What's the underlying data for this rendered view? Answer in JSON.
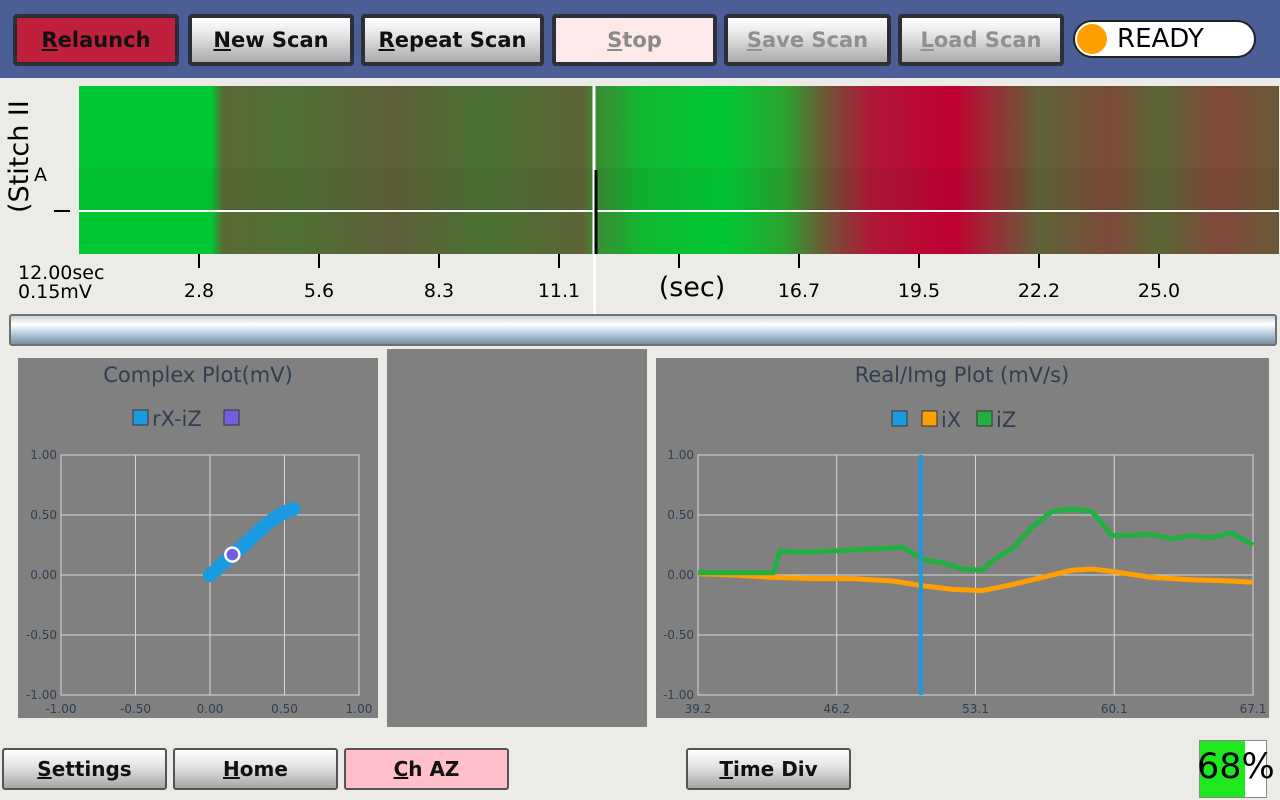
{
  "toolbar": {
    "relaunch": "Relaunch",
    "new_scan": "New Scan",
    "repeat_scan": "Repeat Scan",
    "stop": "Stop",
    "save_scan": "Save Scan",
    "load_scan": "Load Scan",
    "status": "READY",
    "status_color": "#ff9f00"
  },
  "strip": {
    "side_label": "(Stitch II",
    "channel_label": "A",
    "time_div": "12.00sec",
    "volt_div": "0.15mV",
    "axis_unit": "(sec)",
    "ticks": [
      "2.8",
      "5.6",
      "8.3",
      "11.1",
      "16.7",
      "19.5",
      "22.2",
      "25.0"
    ]
  },
  "complex_plot": {
    "title": "Complex Plot(mV)",
    "legend": [
      {
        "label": "rX-iZ",
        "color": "#1a9ae0"
      },
      {
        "label": "",
        "color": "#7060e0"
      }
    ]
  },
  "realimg_plot": {
    "title": "Real/Img Plot (mV/s)",
    "legend": [
      {
        "label": "",
        "color": "#1a9ae0"
      },
      {
        "label": "iX",
        "color": "#ffa000"
      },
      {
        "label": "iZ",
        "color": "#20b040"
      }
    ]
  },
  "chart_data": [
    {
      "type": "scatter",
      "title": "Complex Plot(mV)",
      "xlim": [
        -1.0,
        1.0
      ],
      "ylim": [
        -1.0,
        1.0
      ],
      "xticks": [
        "-1.00",
        "-0.50",
        "0.00",
        "0.50",
        "1.00"
      ],
      "yticks": [
        "1.00",
        "0.50",
        "0.00",
        "-0.50",
        "-1.00"
      ],
      "grid": true,
      "series": [
        {
          "name": "rX-iZ",
          "color": "#1a9ae0",
          "points": [
            [
              0.0,
              0.0
            ],
            [
              0.02,
              0.02
            ],
            [
              0.04,
              0.04
            ],
            [
              0.06,
              0.07
            ],
            [
              0.08,
              0.09
            ],
            [
              0.1,
              0.11
            ],
            [
              0.12,
              0.13
            ],
            [
              0.14,
              0.15
            ],
            [
              0.16,
              0.18
            ],
            [
              0.18,
              0.2
            ],
            [
              0.2,
              0.22
            ],
            [
              0.22,
              0.24
            ],
            [
              0.24,
              0.26
            ],
            [
              0.26,
              0.29
            ],
            [
              0.28,
              0.31
            ],
            [
              0.3,
              0.33
            ],
            [
              0.32,
              0.36
            ],
            [
              0.34,
              0.38
            ],
            [
              0.36,
              0.4
            ],
            [
              0.38,
              0.42
            ],
            [
              0.4,
              0.44
            ],
            [
              0.42,
              0.46
            ],
            [
              0.44,
              0.48
            ],
            [
              0.46,
              0.49
            ],
            [
              0.48,
              0.51
            ],
            [
              0.5,
              0.52
            ],
            [
              0.52,
              0.53
            ],
            [
              0.54,
              0.54
            ],
            [
              0.56,
              0.55
            ]
          ]
        },
        {
          "name": "",
          "color": "#7060e0",
          "points": [
            [
              0.15,
              0.17
            ]
          ]
        }
      ]
    },
    {
      "type": "line",
      "title": "Real/Img Plot (mV/s)",
      "xlim": [
        39.2,
        67.1
      ],
      "ylim": [
        -1.0,
        1.0
      ],
      "xticks": [
        "39.2",
        "46.2",
        "53.1",
        "60.1",
        "67.1"
      ],
      "yticks": [
        "1.00",
        "0.50",
        "0.00",
        "-0.50",
        "-1.00"
      ],
      "grid": true,
      "cursor_x": 50.4,
      "series": [
        {
          "name": "iX",
          "color": "#ffa000",
          "x": [
            39.2,
            41.0,
            43.0,
            45.0,
            47.0,
            49.0,
            50.5,
            52.0,
            53.5,
            55.0,
            56.5,
            58.0,
            59.0,
            60.0,
            62.0,
            64.0,
            66.0,
            67.1
          ],
          "y": [
            0.01,
            0.0,
            -0.02,
            -0.03,
            -0.03,
            -0.05,
            -0.09,
            -0.12,
            -0.13,
            -0.08,
            -0.02,
            0.04,
            0.05,
            0.03,
            -0.02,
            -0.04,
            -0.05,
            -0.06
          ]
        },
        {
          "name": "iZ",
          "color": "#20b040",
          "x": [
            39.2,
            40.5,
            42.0,
            43.0,
            43.3,
            44.5,
            46.0,
            47.0,
            48.5,
            49.5,
            50.5,
            51.5,
            52.5,
            53.5,
            54.0,
            55.0,
            56.0,
            57.0,
            58.0,
            59.0,
            60.0,
            61.0,
            62.0,
            63.0,
            64.0,
            65.0,
            66.0,
            67.1
          ],
          "y": [
            0.02,
            0.02,
            0.02,
            0.02,
            0.2,
            0.19,
            0.2,
            0.21,
            0.22,
            0.23,
            0.13,
            0.1,
            0.05,
            0.04,
            0.12,
            0.22,
            0.4,
            0.53,
            0.55,
            0.53,
            0.33,
            0.33,
            0.34,
            0.3,
            0.33,
            0.31,
            0.35,
            0.25
          ]
        }
      ]
    }
  ],
  "bottom": {
    "settings": "Settings",
    "home": "Home",
    "channel": "Ch AZ",
    "time_div": "Time Div",
    "battery_pct": "68%",
    "battery_level": 0.68
  }
}
